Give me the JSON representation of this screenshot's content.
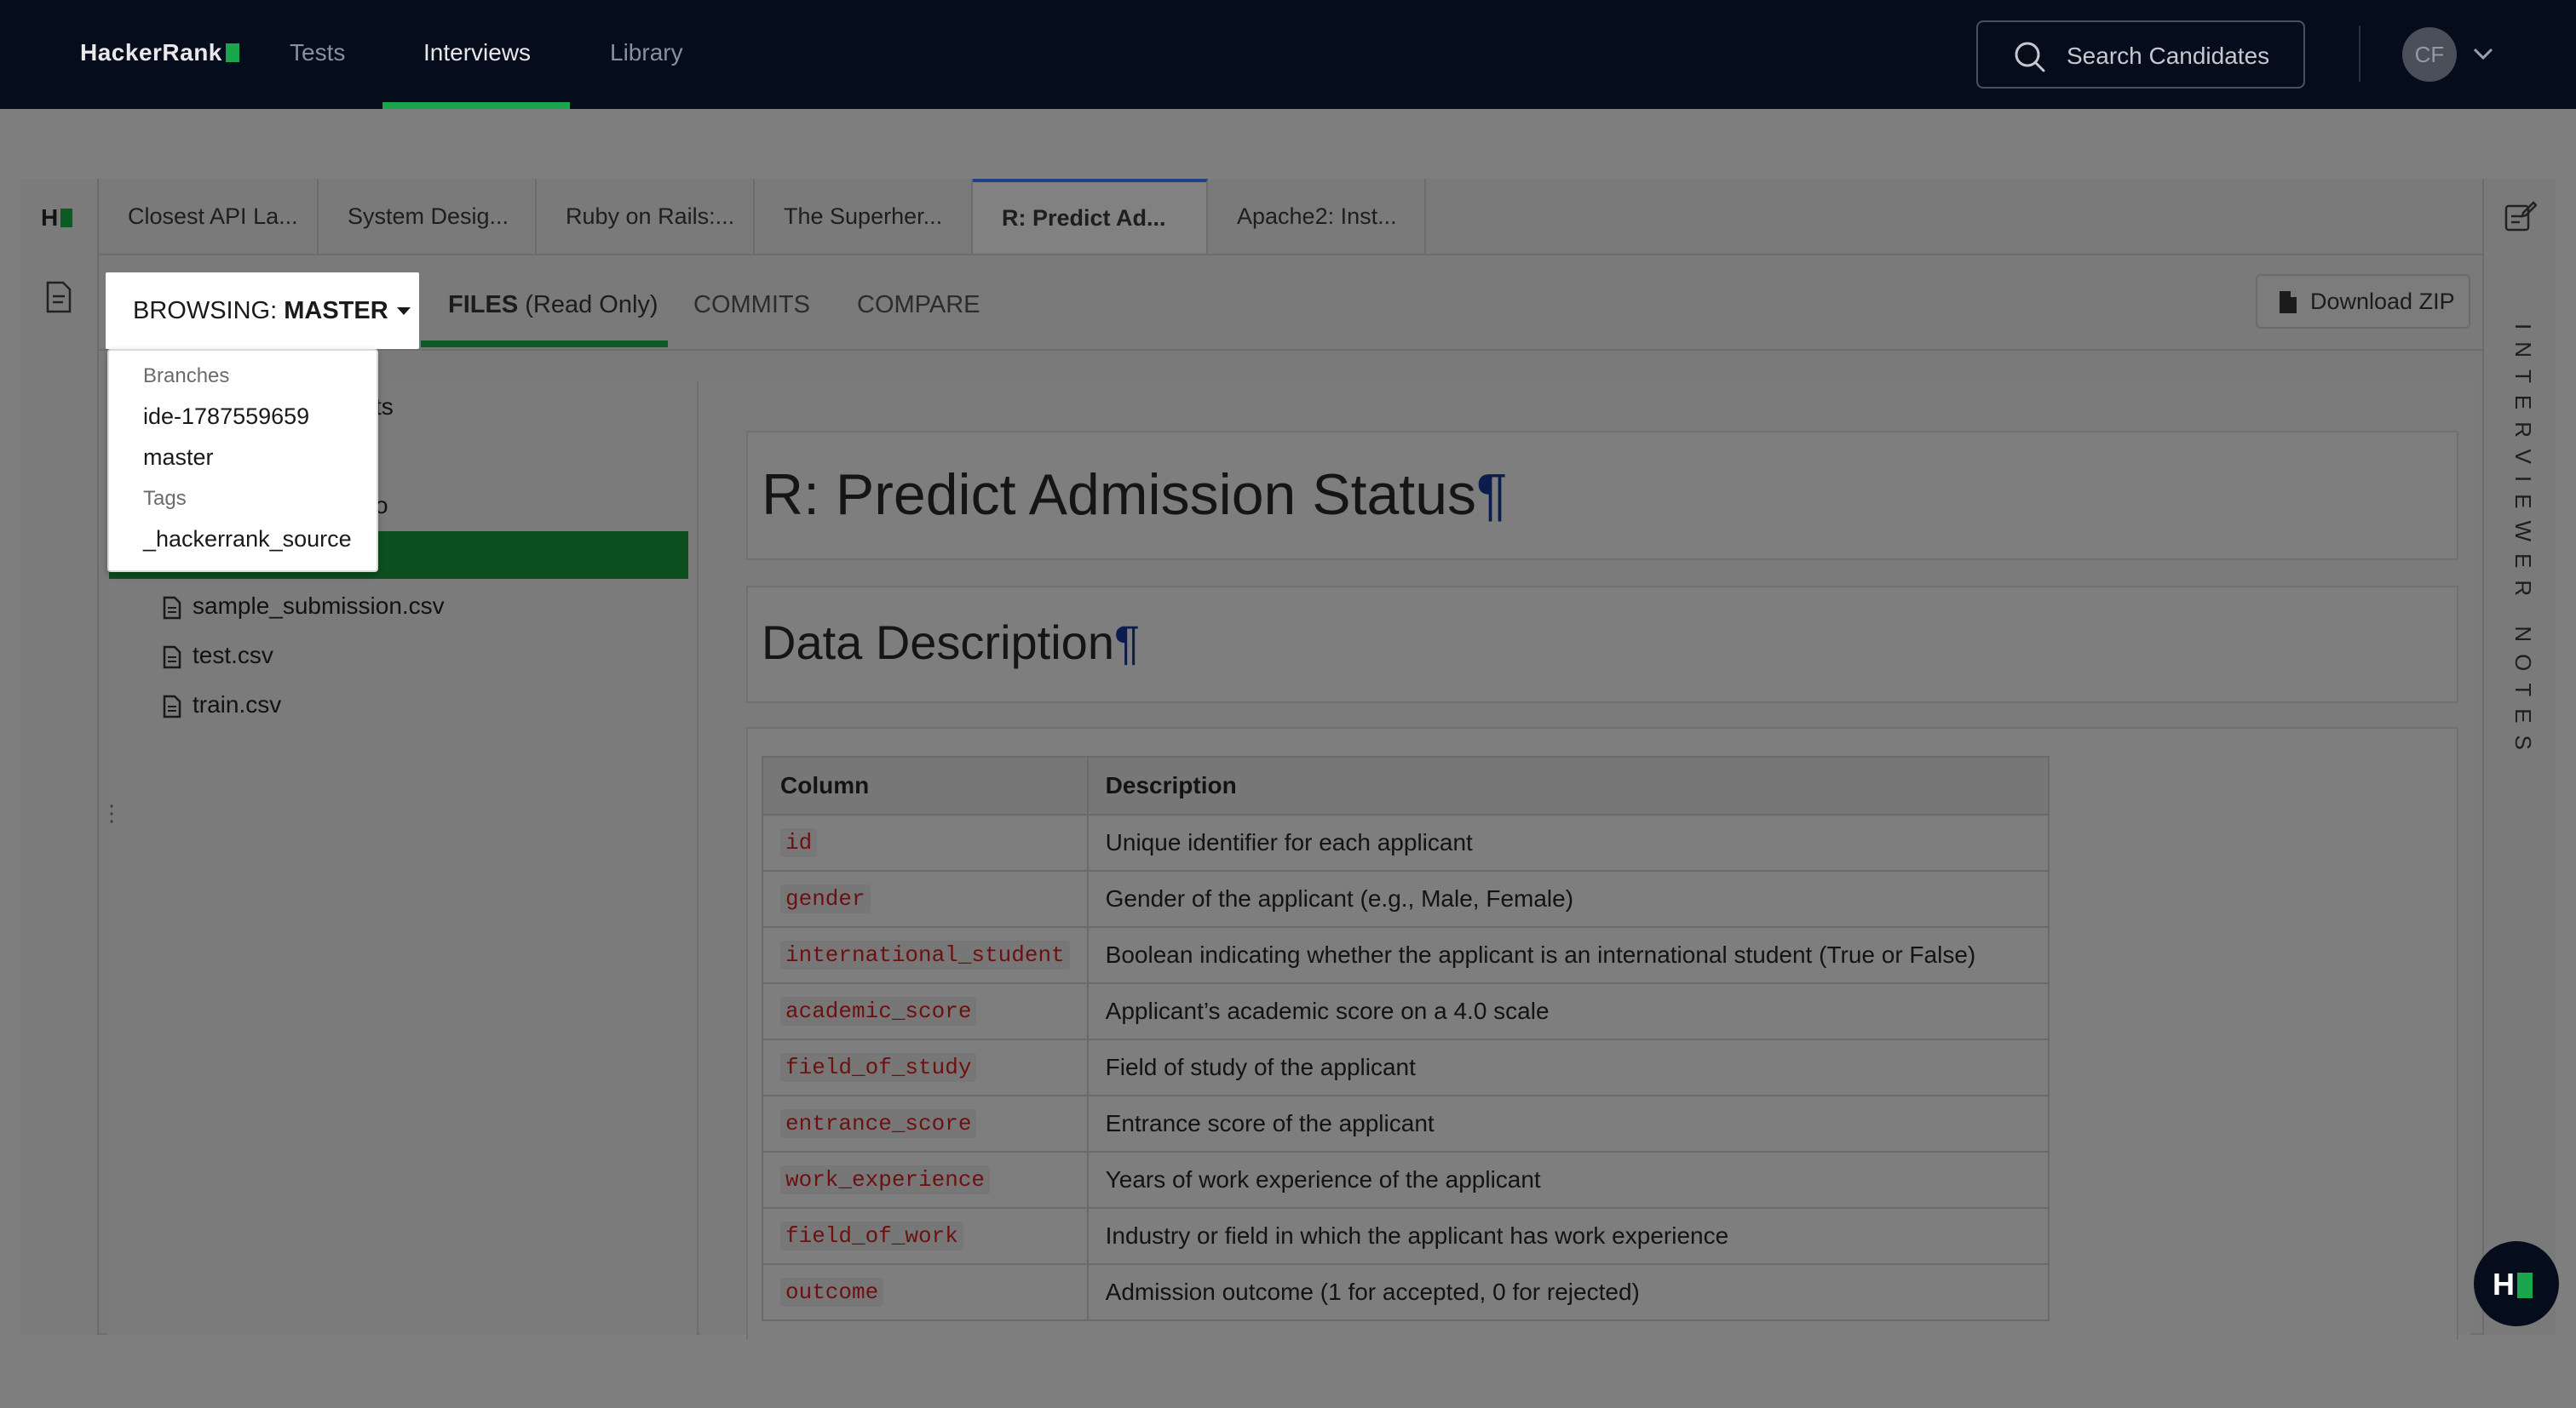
{
  "topnav": {
    "logo": "HackerRank",
    "links": [
      "Tests",
      "Interviews",
      "Library"
    ],
    "active_link": "Interviews",
    "search_label": "Search Candidates",
    "avatar_initials": "CF"
  },
  "rail": {
    "logo": "H"
  },
  "tabs": [
    {
      "label": "Closest API La...",
      "active": false
    },
    {
      "label": "System Desig...",
      "active": false
    },
    {
      "label": "Ruby on Rails:...",
      "active": false
    },
    {
      "label": "The Superher...",
      "active": false
    },
    {
      "label": "R: Predict Ad...",
      "active": true
    },
    {
      "label": "Apache2: Inst...",
      "active": false
    }
  ],
  "right_rail": {
    "vertical_label": "INTERVIEWER NOTES"
  },
  "subbar": {
    "browsing_prefix": "BROWSING:",
    "browsing_value": "MASTER",
    "files_label": "FILES",
    "files_suffix": "(Read Only)",
    "commits_label": "COMMITS",
    "compare_label": "COMPARE",
    "download_label": "Download ZIP"
  },
  "dropdown": {
    "branches_header": "Branches",
    "branches": [
      "ide-1787559659",
      "master"
    ],
    "tags_header": "Tags",
    "tags": [
      "_hackerrank_source"
    ]
  },
  "tree": {
    "partial_1": "ts",
    "partial_2": "o",
    "files": [
      "sample_submission.csv",
      "test.csv",
      "train.csv"
    ]
  },
  "content": {
    "title": "R: Predict Admission Status",
    "section_heading": "Data Description",
    "pilcrow": "¶",
    "table": {
      "headers": [
        "Column",
        "Description"
      ],
      "rows": [
        [
          "id",
          "Unique identifier for each applicant"
        ],
        [
          "gender",
          "Gender of the applicant (e.g., Male, Female)"
        ],
        [
          "international_student",
          "Boolean indicating whether the applicant is an international student (True or False)"
        ],
        [
          "academic_score",
          "Applicant’s academic score on a 4.0 scale"
        ],
        [
          "field_of_study",
          "Field of study of the applicant"
        ],
        [
          "entrance_score",
          "Entrance score of the applicant"
        ],
        [
          "work_experience",
          "Years of work experience of the applicant"
        ],
        [
          "field_of_work",
          "Industry or field in which the applicant has work experience"
        ],
        [
          "outcome",
          "Admission outcome (1 for accepted, 0 for rejected)"
        ]
      ]
    }
  },
  "fab": {
    "label": "H"
  },
  "colors": {
    "nav_bg": "#050c1c",
    "brand_green": "#1aa64c",
    "selected_tree": "#0d4f1f",
    "active_tab_border": "#1f3f87",
    "code_text": "#6d1010"
  }
}
